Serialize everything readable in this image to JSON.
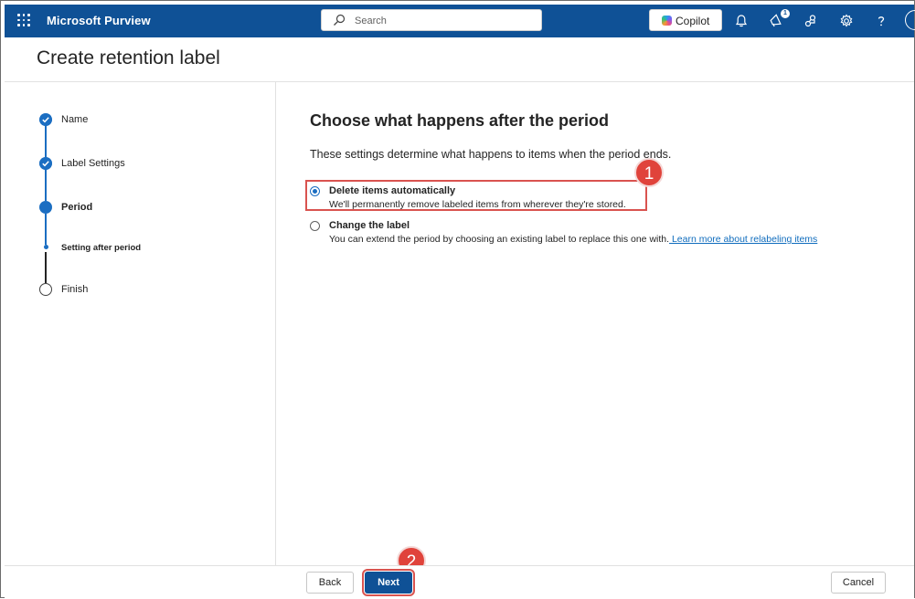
{
  "header": {
    "app_name": "Microsoft Purview",
    "search_placeholder": "Search",
    "copilot_label": "Copilot",
    "notification_badge": "1"
  },
  "page": {
    "title": "Create retention label"
  },
  "steps": [
    {
      "label": "Name",
      "state": "completed"
    },
    {
      "label": "Label Settings",
      "state": "completed"
    },
    {
      "label": "Period",
      "state": "current"
    },
    {
      "label": "Setting after period",
      "state": "current-substep"
    },
    {
      "label": "Finish",
      "state": "pending"
    }
  ],
  "main": {
    "heading": "Choose what happens after the period",
    "description": "These settings determine what happens to items when the period ends.",
    "options": [
      {
        "title": "Delete items automatically",
        "description": "We'll permanently remove labeled items from wherever they're stored.",
        "selected": true
      },
      {
        "title": "Change the label",
        "description": "You can extend the period by choosing an existing label to replace this one with.",
        "link": " Learn more about relabeling items",
        "selected": false
      }
    ]
  },
  "annotations": {
    "callout_1": "1",
    "callout_2": "2"
  },
  "footer": {
    "back_label": "Back",
    "next_label": "Next",
    "cancel_label": "Cancel"
  },
  "colors": {
    "brand": "#0f5196",
    "accent": "#1b6ec2",
    "callout": "#e0433b"
  }
}
